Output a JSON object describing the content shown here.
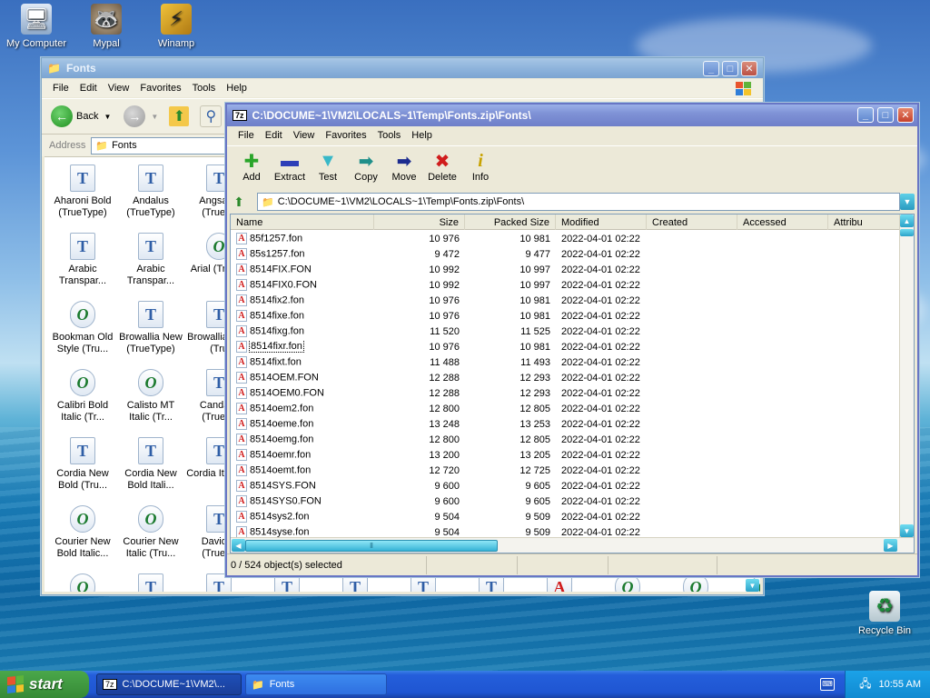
{
  "desktop": {
    "icons": [
      {
        "label": "My Computer"
      },
      {
        "label": "Mypal"
      },
      {
        "label": "Winamp"
      },
      {
        "label": "Recycle Bin"
      }
    ]
  },
  "explorer": {
    "title": "Fonts",
    "menu": [
      "File",
      "Edit",
      "View",
      "Favorites",
      "Tools",
      "Help"
    ],
    "back_label": "Back",
    "address_label": "Address",
    "address_value": "Fonts",
    "fonts": [
      {
        "name": "Aharoni Bold (TrueType)",
        "type": "tt"
      },
      {
        "name": "Andalus (TrueType)",
        "type": "tt"
      },
      {
        "name": "Angsana (TrueTy",
        "type": "tt"
      },
      {
        "name": "Arabic Transpar...",
        "type": "tt"
      },
      {
        "name": "Arabic Transpar...",
        "type": "tt"
      },
      {
        "name": "Arial (TrueTy",
        "type": "ot"
      },
      {
        "name": "Bookman Old Style (Tru...",
        "type": "ot"
      },
      {
        "name": "Browallia New (TrueType)",
        "type": "tt"
      },
      {
        "name": "Browallia Bold (Tru",
        "type": "tt"
      },
      {
        "name": "Calibri Bold Italic (Tr...",
        "type": "ot"
      },
      {
        "name": "Calisto MT Italic (Tr...",
        "type": "ot"
      },
      {
        "name": "Candara (TrueTy",
        "type": "tt"
      },
      {
        "name": "Cordia New Bold (Tru...",
        "type": "tt"
      },
      {
        "name": "Cordia New Bold Itali...",
        "type": "tt"
      },
      {
        "name": "Cordia Italic (T",
        "type": "tt"
      },
      {
        "name": "Courier New Bold Italic...",
        "type": "ot"
      },
      {
        "name": "Courier New Italic (Tru...",
        "type": "ot"
      },
      {
        "name": "David B (TrueTy",
        "type": "tt"
      }
    ],
    "bottom_row_icons": [
      "ot",
      "tt",
      "tt",
      "tt",
      "tt",
      "tt",
      "tt",
      "bm",
      "ot",
      "ot",
      "ot"
    ]
  },
  "zip": {
    "title": "C:\\DOCUME~1\\VM2\\LOCALS~1\\Temp\\Fonts.zip\\Fonts\\",
    "app_badge": "7z",
    "menu": [
      "File",
      "Edit",
      "View",
      "Favorites",
      "Tools",
      "Help"
    ],
    "toolbar": [
      {
        "label": "Add",
        "icon": "plus-icon",
        "glyph": "✚",
        "color": "#2aa52a"
      },
      {
        "label": "Extract",
        "icon": "minus-icon",
        "glyph": "▬",
        "color": "#2d3fb8"
      },
      {
        "label": "Test",
        "icon": "check-icon",
        "glyph": "▼",
        "color": "#38b8c8"
      },
      {
        "label": "Copy",
        "icon": "copy-arrow-icon",
        "glyph": "➡",
        "color": "#1f8f8a"
      },
      {
        "label": "Move",
        "icon": "move-arrow-icon",
        "glyph": "➡",
        "color": "#1b2b8f"
      },
      {
        "label": "Delete",
        "icon": "delete-x-icon",
        "glyph": "✖",
        "color": "#d01c1c"
      },
      {
        "label": "Info",
        "icon": "info-icon",
        "glyph": "i",
        "color": "#c8a200"
      }
    ],
    "path": "C:\\DOCUME~1\\VM2\\LOCALS~1\\Temp\\Fonts.zip\\Fonts\\",
    "columns": [
      "Name",
      "Size",
      "Packed Size",
      "Modified",
      "Created",
      "Accessed",
      "Attribu"
    ],
    "rows": [
      {
        "name": "85f1257.fon",
        "size": "10 976",
        "packed": "10 981",
        "modified": "2022-04-01 02:22"
      },
      {
        "name": "85s1257.fon",
        "size": "9 472",
        "packed": "9 477",
        "modified": "2022-04-01 02:22"
      },
      {
        "name": "8514FIX.FON",
        "size": "10 992",
        "packed": "10 997",
        "modified": "2022-04-01 02:22"
      },
      {
        "name": "8514FIX0.FON",
        "size": "10 992",
        "packed": "10 997",
        "modified": "2022-04-01 02:22"
      },
      {
        "name": "8514fix2.fon",
        "size": "10 976",
        "packed": "10 981",
        "modified": "2022-04-01 02:22"
      },
      {
        "name": "8514fixe.fon",
        "size": "10 976",
        "packed": "10 981",
        "modified": "2022-04-01 02:22"
      },
      {
        "name": "8514fixg.fon",
        "size": "11 520",
        "packed": "11 525",
        "modified": "2022-04-01 02:22"
      },
      {
        "name": "8514fixr.fon",
        "size": "10 976",
        "packed": "10 981",
        "modified": "2022-04-01 02:22"
      },
      {
        "name": "8514fixt.fon",
        "size": "11 488",
        "packed": "11 493",
        "modified": "2022-04-01 02:22"
      },
      {
        "name": "8514OEM.FON",
        "size": "12 288",
        "packed": "12 293",
        "modified": "2022-04-01 02:22"
      },
      {
        "name": "8514OEM0.FON",
        "size": "12 288",
        "packed": "12 293",
        "modified": "2022-04-01 02:22"
      },
      {
        "name": "8514oem2.fon",
        "size": "12 800",
        "packed": "12 805",
        "modified": "2022-04-01 02:22"
      },
      {
        "name": "8514oeme.fon",
        "size": "13 248",
        "packed": "13 253",
        "modified": "2022-04-01 02:22"
      },
      {
        "name": "8514oemg.fon",
        "size": "12 800",
        "packed": "12 805",
        "modified": "2022-04-01 02:22"
      },
      {
        "name": "8514oemr.fon",
        "size": "13 200",
        "packed": "13 205",
        "modified": "2022-04-01 02:22"
      },
      {
        "name": "8514oemt.fon",
        "size": "12 720",
        "packed": "12 725",
        "modified": "2022-04-01 02:22"
      },
      {
        "name": "8514SYS.FON",
        "size": "9 600",
        "packed": "9 605",
        "modified": "2022-04-01 02:22"
      },
      {
        "name": "8514SYS0.FON",
        "size": "9 600",
        "packed": "9 605",
        "modified": "2022-04-01 02:22"
      },
      {
        "name": "8514sys2.fon",
        "size": "9 504",
        "packed": "9 509",
        "modified": "2022-04-01 02:22"
      },
      {
        "name": "8514syse.fon",
        "size": "9 504",
        "packed": "9 509",
        "modified": "2022-04-01 02:22"
      }
    ],
    "focused_row": 7,
    "status": "0 / 524 object(s) selected",
    "hscroll_grip": "⦀"
  },
  "taskbar": {
    "start_label": "start",
    "buttons": [
      {
        "label": "C:\\DOCUME~1\\VM2\\...",
        "badge": "7z"
      },
      {
        "label": "Fonts"
      }
    ],
    "clock": "10:55 AM"
  }
}
